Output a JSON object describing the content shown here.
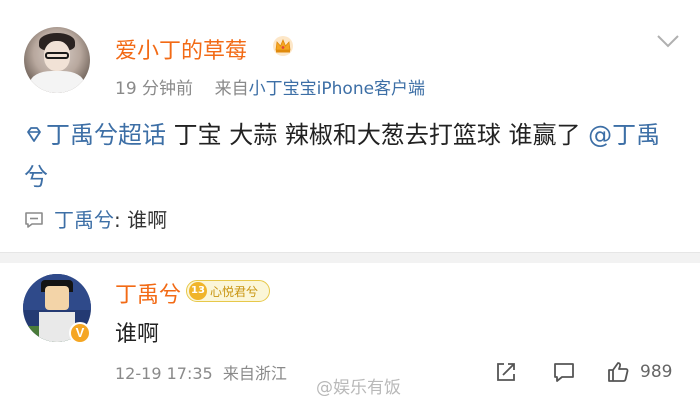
{
  "post": {
    "username": "爱小丁的草莓",
    "badge_icon": "crown-icon",
    "time": "19 分钟前",
    "source_prefix": "来自",
    "source": "小丁宝宝iPhone客户端",
    "topic": "丁禹兮超话",
    "text": " 丁宝 大蒜 辣椒和大葱去打篮球 谁赢了 ",
    "mention": "@丁禹兮",
    "comment_preview": {
      "name": "丁禹兮",
      "text": ": 谁啊"
    }
  },
  "reply": {
    "username": "丁禹兮",
    "level": "13",
    "level_label": "心悦君兮",
    "verified": "V",
    "text": "谁啊",
    "time": "12-19 17:35",
    "location": "来自浙江",
    "like_count": "989"
  },
  "watermark": "@娱乐有饭",
  "colors": {
    "accent_orange": "#f26a15",
    "link_blue": "#3d6fa6",
    "meta_gray": "#8a8a8a"
  }
}
